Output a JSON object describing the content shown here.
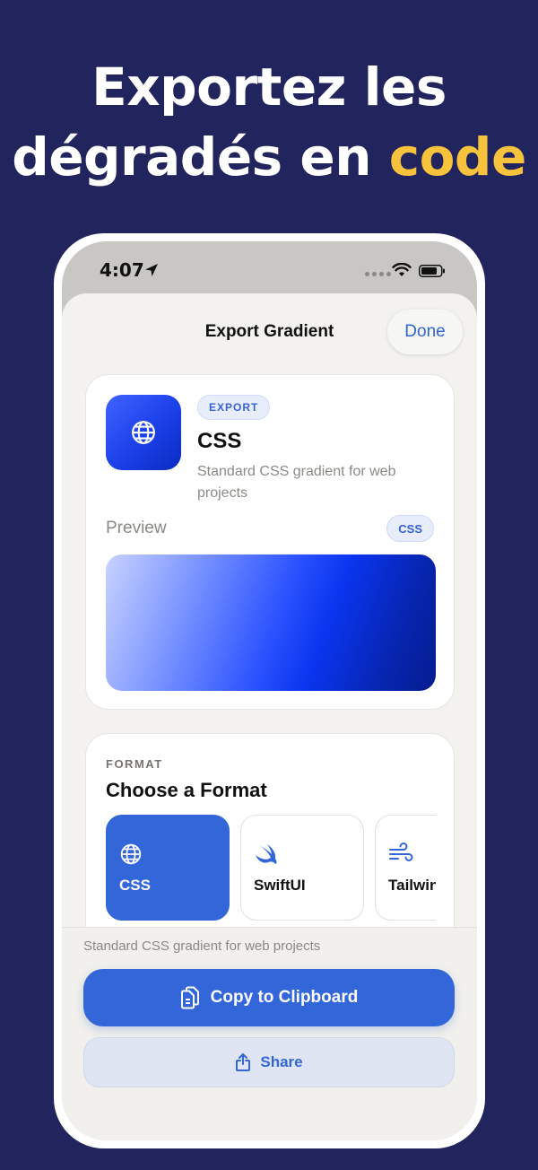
{
  "headline": {
    "line1": "Exportez les",
    "line2_prefix": "dégradés en ",
    "line2_accent": "code"
  },
  "colors": {
    "background": "#22245e",
    "accent": "#f8c33c",
    "primary": "#3366d8"
  },
  "status_bar": {
    "time": "4:07"
  },
  "sheet": {
    "title": "Export Gradient",
    "done_label": "Done"
  },
  "export_card": {
    "badge": "EXPORT",
    "format_name": "CSS",
    "description": "Standard CSS gradient for web projects",
    "preview_label": "Preview",
    "preview_badge": "CSS"
  },
  "format_card": {
    "eyebrow": "FORMAT",
    "heading": "Choose a Format",
    "options": [
      {
        "label": "CSS",
        "icon": "globe-icon",
        "selected": true
      },
      {
        "label": "SwiftUI",
        "icon": "swift-icon",
        "selected": false
      },
      {
        "label": "Tailwin",
        "icon": "wind-icon",
        "selected": false
      }
    ]
  },
  "bottom": {
    "description": "Standard CSS gradient for web projects",
    "copy_label": "Copy to Clipboard",
    "share_label": "Share"
  }
}
